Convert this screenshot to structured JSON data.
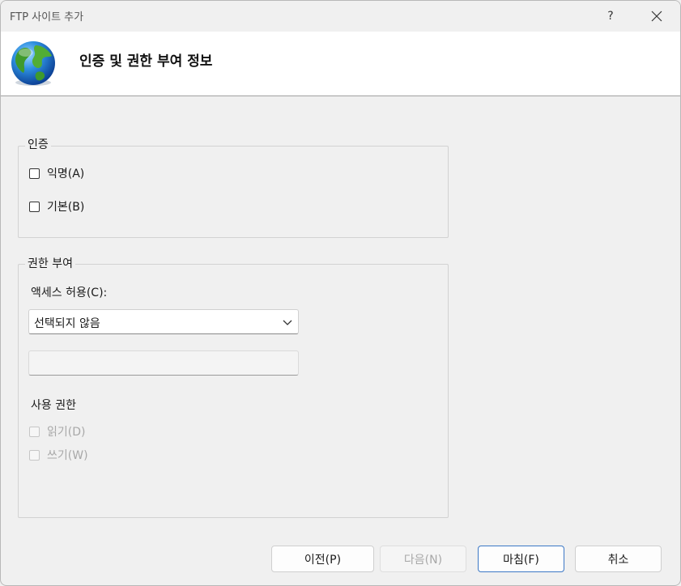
{
  "window": {
    "title": "FTP 사이트 추가",
    "help_label": "?"
  },
  "header": {
    "title": "인증 및 권한 부여 정보"
  },
  "authentication": {
    "legend": "인증",
    "anonymous_label": "익명(A)",
    "anonymous_checked": false,
    "basic_label": "기본(B)",
    "basic_checked": false
  },
  "authorization": {
    "legend": "권한 부여",
    "access_label": "액세스 허용(C):",
    "access_value": "선택되지 않음",
    "access_text": "",
    "permissions_label": "사용 권한",
    "read_label": "읽기(D)",
    "read_checked": false,
    "write_label": "쓰기(W)",
    "write_checked": false
  },
  "buttons": {
    "previous": "이전(P)",
    "next": "다음(N)",
    "finish": "마침(F)",
    "cancel": "취소"
  },
  "colors": {
    "accent_border": "#3c78c6",
    "header_bg": "#ffffff",
    "window_bg": "#f0f0f0"
  },
  "icons": {
    "header": "globe-icon",
    "close": "close-icon",
    "dropdown": "chevron-down-icon"
  }
}
